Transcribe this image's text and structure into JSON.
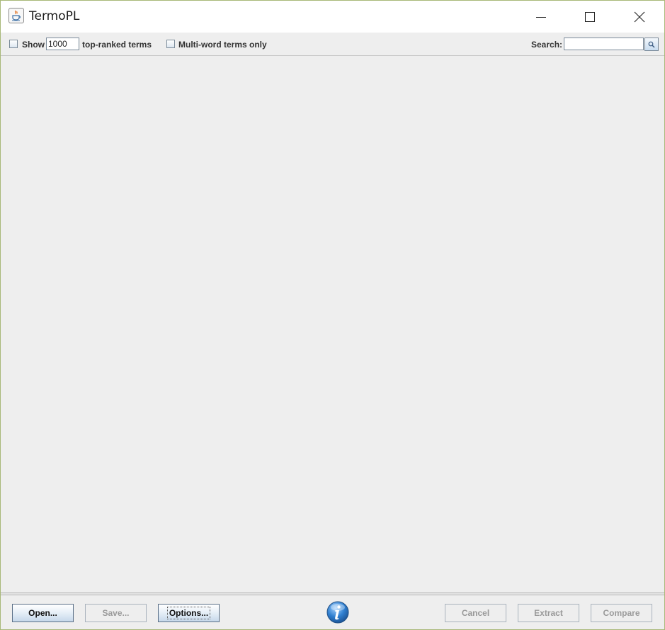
{
  "window": {
    "title": "TermoPL",
    "app_icon": "java-cup-icon"
  },
  "toolbar": {
    "show_label": "Show",
    "top_n_value": "1000",
    "top_ranked_label": "top-ranked terms",
    "multiword_label": "Multi-word terms only",
    "search_label": "Search:",
    "search_value": "",
    "search_icon": "magnifier-icon"
  },
  "buttons": {
    "open": "Open...",
    "save": "Save...",
    "options": "Options...",
    "info_icon": "info-icon",
    "cancel": "Cancel",
    "extract": "Extract",
    "compare": "Compare"
  },
  "colors": {
    "window_border": "#a8b878",
    "panel_background": "#eeeeee",
    "button_gradient_end": "#c6d8ea",
    "info_blue": "#2f7fd0"
  }
}
